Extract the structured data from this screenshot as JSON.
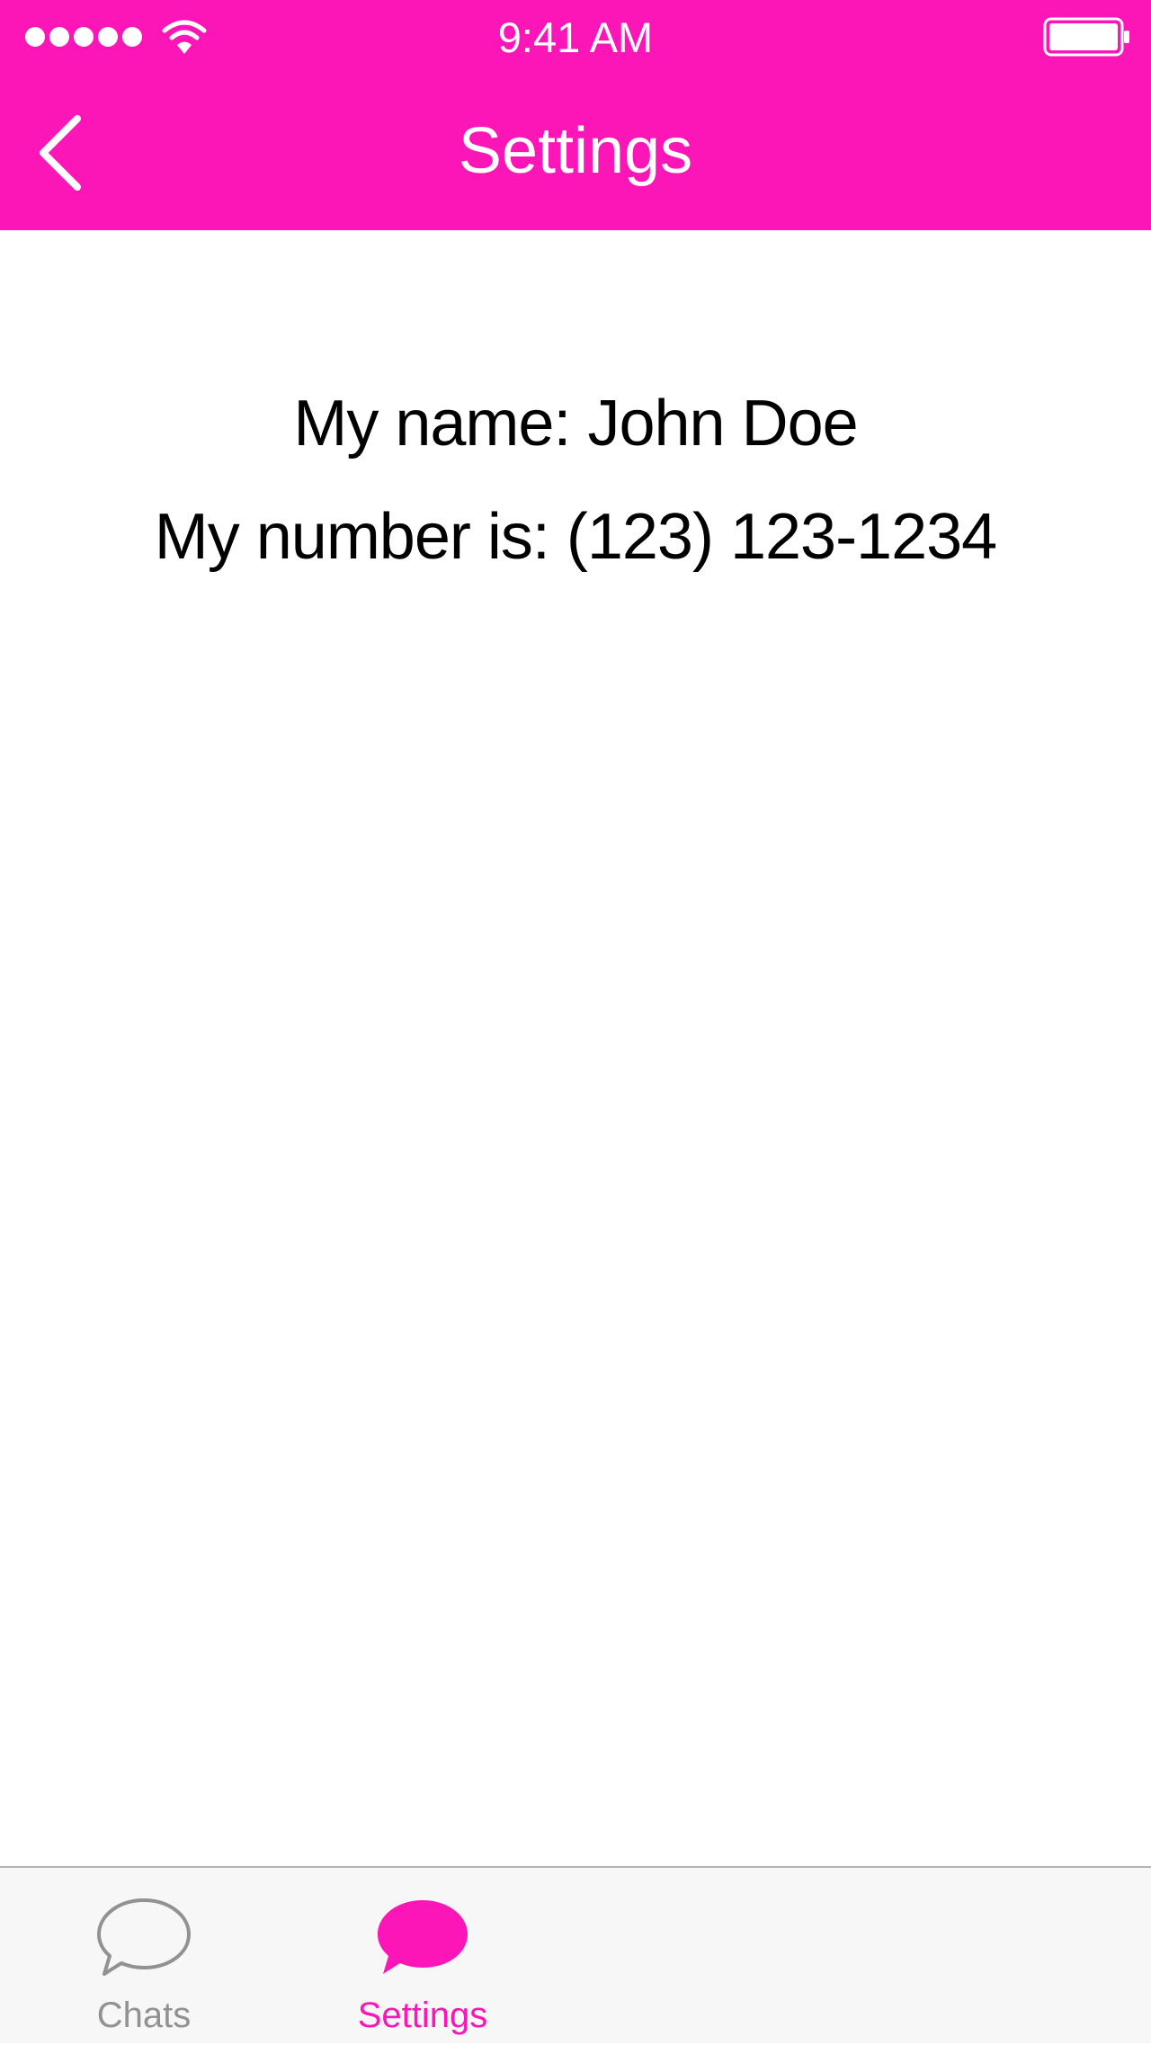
{
  "colors": {
    "accent": "#fc16b8",
    "inactive_tab": "#929292",
    "tab_bar_background": "#f7f7f7"
  },
  "status_bar": {
    "time": "9:41 AM",
    "signal_icon": "signal-dots-icon",
    "wifi_icon": "wifi-icon",
    "battery_icon": "battery-icon"
  },
  "nav": {
    "title": "Settings",
    "back_icon": "chevron-left-icon"
  },
  "profile": {
    "name_line": "My name: John Doe",
    "number_line": "My number is: (123) 123-1234"
  },
  "tab_bar": {
    "tabs": [
      {
        "label": "Chats",
        "icon": "chat-bubble-outline-icon",
        "selected": false
      },
      {
        "label": "Settings",
        "icon": "chat-bubble-filled-icon",
        "selected": true
      }
    ]
  }
}
